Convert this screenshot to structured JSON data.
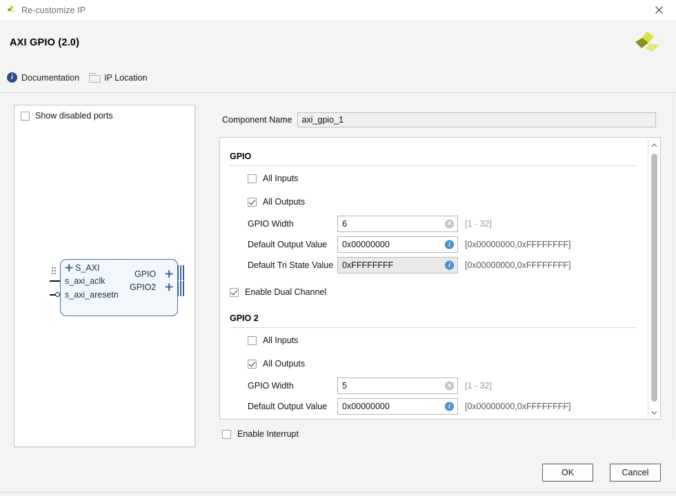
{
  "window": {
    "title": "Re-customize IP",
    "icon": "xilinx-logo-icon",
    "close_label": "✕"
  },
  "header": {
    "ip_title": "AXI GPIO (2.0)",
    "logo": "xilinx-logo",
    "links": [
      {
        "label": "Documentation",
        "icon": "info-icon"
      },
      {
        "label": "IP Location",
        "icon": "folder-icon"
      }
    ]
  },
  "left_panel": {
    "show_disabled_ports": {
      "label": "Show disabled ports",
      "checked": false
    },
    "symbol": {
      "left_ports": [
        "S_AXI",
        "s_axi_aclk",
        "s_axi_aresetn"
      ],
      "right_ports": [
        "GPIO",
        "GPIO2"
      ]
    }
  },
  "component": {
    "label": "Component Name",
    "value": "axi_gpio_1",
    "placeholder": ""
  },
  "gpio": {
    "section_title": "GPIO",
    "all_inputs": {
      "label": "All Inputs",
      "checked": false
    },
    "all_outputs": {
      "label": "All Outputs",
      "checked": true
    },
    "width": {
      "label": "GPIO Width",
      "value": "6",
      "hint": "[1 - 32]",
      "trailing_icon": "clear-icon"
    },
    "default_output": {
      "label": "Default Output Value",
      "value": "0x00000000",
      "hint": "[0x00000000,0xFFFFFFFF]",
      "trailing_icon": "info-icon"
    },
    "default_tristate": {
      "label": "Default Tri State Value",
      "value": "0xFFFFFFFF",
      "hint": "[0x00000000,0xFFFFFFFF]",
      "trailing_icon": "info-icon",
      "disabled": true
    }
  },
  "dual_channel": {
    "label": "Enable Dual Channel",
    "checked": true
  },
  "gpio2": {
    "section_title": "GPIO 2",
    "all_inputs": {
      "label": "All Inputs",
      "checked": false
    },
    "all_outputs": {
      "label": "All Outputs",
      "checked": true
    },
    "width": {
      "label": "GPIO Width",
      "value": "5",
      "hint": "[1 - 32]",
      "trailing_icon": "clear-icon"
    },
    "default_output": {
      "label": "Default Output Value",
      "value": "0x00000000",
      "hint": "[0x00000000,0xFFFFFFFF]",
      "trailing_icon": "info-icon"
    }
  },
  "enable_interrupt": {
    "label": "Enable Interrupt",
    "checked": false
  },
  "buttons": {
    "ok": "OK",
    "cancel": "Cancel"
  },
  "scrollbar": {
    "up": "▲",
    "down": "▼"
  },
  "colors": {
    "accent_blue": "#35609e",
    "info_blue": "#4a95d8",
    "doc_blue": "#2c4a86",
    "logo_olive": "#8a8f1e",
    "logo_lime": "#d9e04b",
    "block_fill": "#f2f7fb",
    "block_border": "#4a6f9c"
  }
}
